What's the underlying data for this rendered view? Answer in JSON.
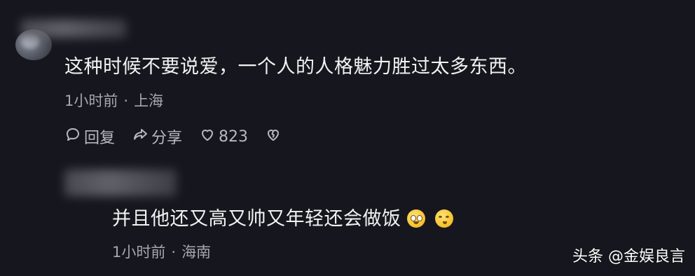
{
  "colors": {
    "background": "#16161e",
    "comment_text": "#f2f2f2",
    "meta_text": "#a6a6ac",
    "action_text": "#b8b8be",
    "emoji": "#f7c531"
  },
  "comments": [
    {
      "text": "这种时候不要说爱，一个人的人格魅力胜过太多东西。",
      "time": "1小时前",
      "separator": "·",
      "location": "上海",
      "actions": {
        "reply_label": "回复",
        "reply_icon": "chat-bubble-icon",
        "share_label": "分享",
        "share_icon": "share-arrow-icon",
        "like_count": "823",
        "like_icon": "heart-icon",
        "dislike_icon": "broken-heart-icon"
      }
    },
    {
      "text": "并且他还又高又帅又年轻还会做饭",
      "emojis": [
        "pleading-face-emoji",
        "thinking-face-emoji"
      ],
      "time": "1小时前",
      "separator": "·",
      "location": "海南"
    }
  ],
  "watermark": "头条 @金娱良言"
}
